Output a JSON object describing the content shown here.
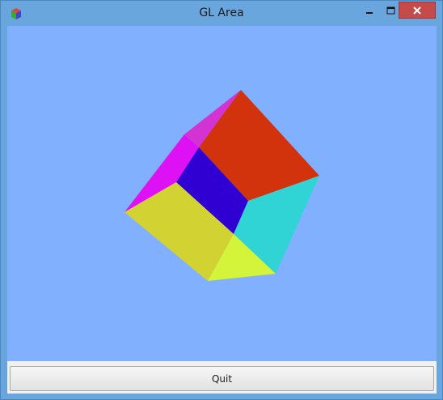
{
  "window": {
    "title": "GL Area",
    "controls": {
      "minimize_icon": "minimize-icon",
      "maximize_icon": "maximize-icon",
      "close_icon": "close-icon"
    }
  },
  "gl_area": {
    "background_color": "#80b0ff",
    "scene": "rotating-cube",
    "face_colors": {
      "top": "#d2320c",
      "upper_left": "#d433d4",
      "left_edge": "#de10f4",
      "front_dark": "#3000d2",
      "left_yellow": "#d2d232",
      "right_cyan": "#30d4d4",
      "bottom_lime": "#d4f43a"
    }
  },
  "buttons": {
    "quit_label": "Quit"
  }
}
